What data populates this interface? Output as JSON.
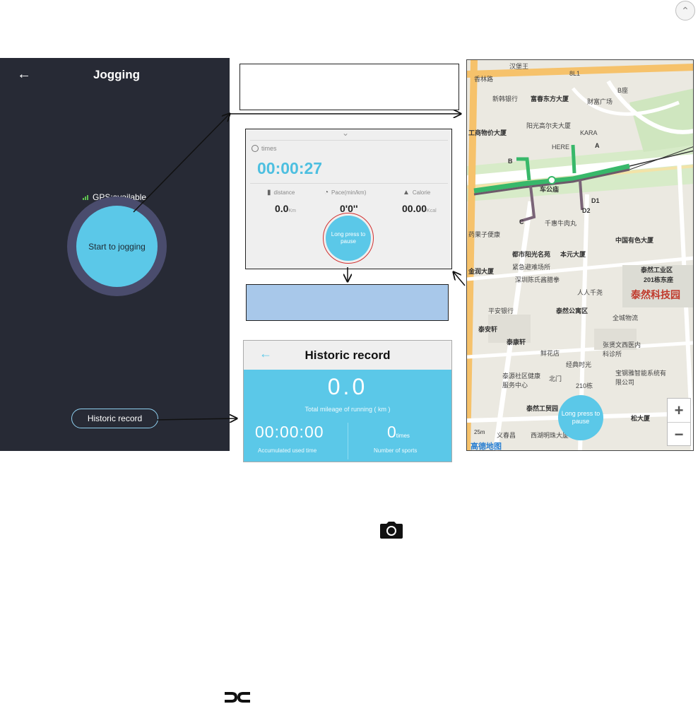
{
  "scroll_top": {
    "glyph": "⌃⌃"
  },
  "jogging_screen": {
    "back_glyph": "←",
    "title": "Jogging",
    "gps_status": "GPS:available",
    "start_button": "Start to jogging",
    "historic_button": "Historic record"
  },
  "running_panel": {
    "times_label": "times",
    "timer": "00:00:27",
    "distance_label": "distance",
    "distance_value": "0.0",
    "distance_unit": "Km",
    "pace_label": "Pace(min/km)",
    "pace_value": "0'0''",
    "calorie_label": "Calorie",
    "calorie_value": "00.00",
    "calorie_unit": "Kcal",
    "pause_button": "Long press to pause"
  },
  "historic_panel": {
    "back_glyph": "←",
    "title": "Historic record",
    "total_mileage": "0.0",
    "total_mileage_label": "Total mileage of running ( km )",
    "accumulated_time": "00:00:00",
    "accumulated_time_label": "Accumulated used time",
    "sports_count": "0",
    "sports_count_unit": "times",
    "sports_count_label": "Number of sports"
  },
  "map": {
    "labels": [
      {
        "t": "汉堡王"
      },
      {
        "t": "香林路"
      },
      {
        "t": "8L1"
      },
      {
        "t": "B座"
      },
      {
        "t": "新韩银行"
      },
      {
        "t": "富春东方大厦"
      },
      {
        "t": "财富广场"
      },
      {
        "t": "工商物价大厦"
      },
      {
        "t": "阳光高尔夫大厦"
      },
      {
        "t": "KARA"
      },
      {
        "t": "HERE"
      },
      {
        "t": "A"
      },
      {
        "t": "B"
      },
      {
        "t": "车公庙"
      },
      {
        "t": "D1"
      },
      {
        "t": "D2"
      },
      {
        "t": "C"
      },
      {
        "t": "千惠牛肉丸"
      },
      {
        "t": "药果子便康"
      },
      {
        "t": "都市阳光名苑"
      },
      {
        "t": "本元大厦"
      },
      {
        "t": "中国有色大厦"
      },
      {
        "t": "紧急避难场所"
      },
      {
        "t": "泰然工业区"
      },
      {
        "t": "201栋东座"
      },
      {
        "t": "泰然科技园"
      },
      {
        "t": "金润大厦"
      },
      {
        "t": "深圳陈氏酱腊拳"
      },
      {
        "t": "人人千尧"
      },
      {
        "t": "平安银行"
      },
      {
        "t": "泰然公寓区"
      },
      {
        "t": "全城物流"
      },
      {
        "t": "泰安轩"
      },
      {
        "t": "泰康轩"
      },
      {
        "t": "鲜花店"
      },
      {
        "t": "张贤文西医内科诊所"
      },
      {
        "t": "经典时光"
      },
      {
        "t": "210栋"
      },
      {
        "t": "泰源社区健康服务中心"
      },
      {
        "t": "北门"
      },
      {
        "t": "宝钢雅智能系统有限公司"
      },
      {
        "t": "泰然工贸园"
      },
      {
        "t": "松大厦"
      },
      {
        "t": "义春昌"
      },
      {
        "t": "西湖明珠大厦"
      }
    ],
    "pause_button": "Long press to pause",
    "zoom_in": "+",
    "zoom_out": "−",
    "scale": "25m",
    "logo": "高德地图"
  },
  "colors": {
    "accent_blue": "#5bc8e8",
    "dark_bg": "#272a35",
    "annotation_blue": "#a8c8ea",
    "route_green": "#38b86a"
  },
  "icons": {
    "camera": "camera-icon",
    "link": "link-icon"
  }
}
